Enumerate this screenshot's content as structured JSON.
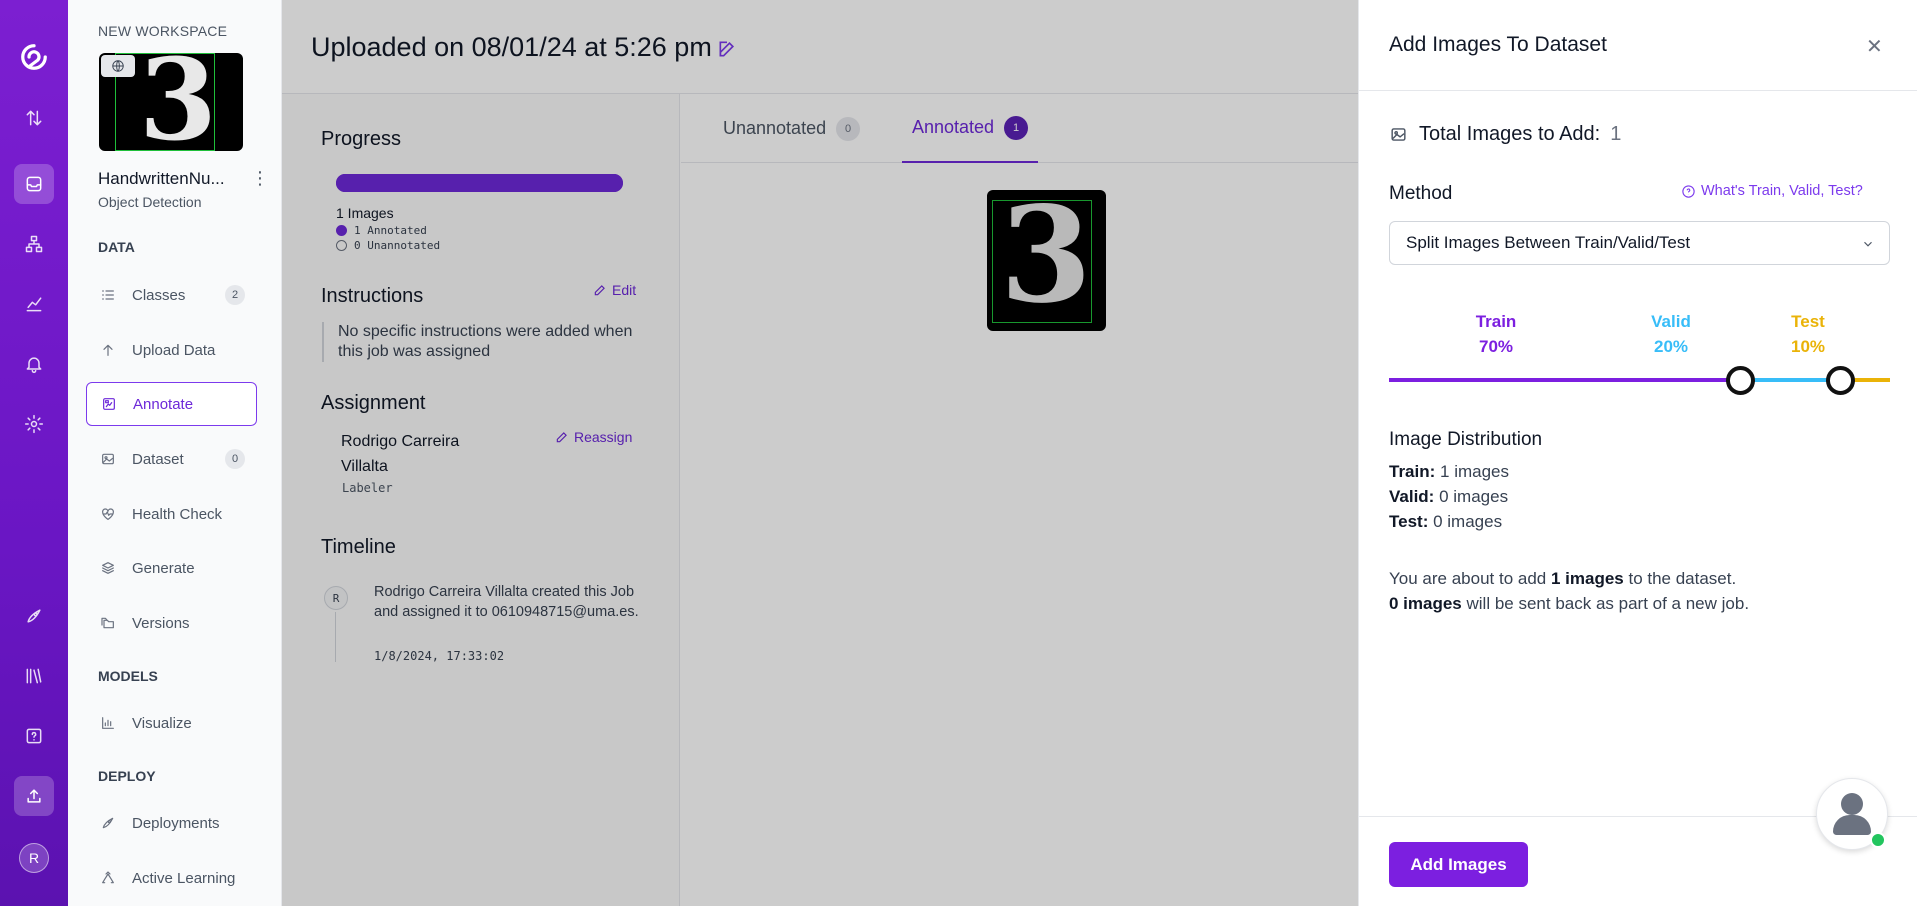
{
  "rail": {
    "items": [
      "logo-icon",
      "transfer-icon",
      "inbox-icon",
      "sitemap-icon",
      "chart-icon",
      "bell-icon",
      "gear-icon",
      "rocket-icon",
      "library-icon",
      "help-icon",
      "upload-icon"
    ],
    "avatar_initial": "R"
  },
  "sidebar": {
    "workspace_label": "NEW WORKSPACE",
    "project_name": "HandwrittenNu...",
    "project_type": "Object Detection",
    "sections": {
      "data": "DATA",
      "models": "MODELS",
      "deploy": "DEPLOY"
    },
    "items": [
      {
        "label": "Classes",
        "count": "2",
        "icon": "list-icon"
      },
      {
        "label": "Upload Data",
        "icon": "arrow-up-icon"
      },
      {
        "label": "Annotate",
        "icon": "annotate-icon",
        "active": true
      },
      {
        "label": "Dataset",
        "count": "0",
        "icon": "image-icon"
      },
      {
        "label": "Health Check",
        "icon": "heart-pulse-icon"
      },
      {
        "label": "Generate",
        "icon": "layers-icon"
      },
      {
        "label": "Versions",
        "icon": "folders-icon"
      },
      {
        "label": "Visualize",
        "icon": "bar-chart-icon"
      },
      {
        "label": "Deployments",
        "icon": "rocket-icon"
      },
      {
        "label": "Active Learning",
        "icon": "recycle-icon"
      }
    ]
  },
  "header": {
    "title": "Uploaded on 08/01/24 at 5:26 pm"
  },
  "progress": {
    "title": "Progress",
    "annotated_fraction": 1.0,
    "images_text": "1 Images",
    "annotated_text": "1 Annotated",
    "unannotated_text": "0 Unannotated"
  },
  "instructions": {
    "title": "Instructions",
    "edit_label": "Edit",
    "text": "No specific instructions were added when this job was assigned"
  },
  "assignment": {
    "title": "Assignment",
    "name": "Rodrigo Carreira Villalta",
    "role": "Labeler",
    "reassign_label": "Reassign"
  },
  "timeline": {
    "title": "Timeline",
    "avatar": "R",
    "text": "Rodrigo Carreira Villalta created this Job and assigned it to 0610948715@uma.es.",
    "time": "1/8/2024, 17:33:02"
  },
  "tabs": [
    {
      "label": "Unannotated",
      "count": "0"
    },
    {
      "label": "Annotated",
      "count": "1",
      "active": true
    }
  ],
  "drawer": {
    "title": "Add Images To Dataset",
    "close": "✕",
    "total_label": "Total Images to Add:",
    "total_value": "1",
    "method_label": "Method",
    "help_link": "What's Train, Valid, Test?",
    "method_value": "Split Images Between Train/Valid/Test",
    "split": {
      "train": {
        "label": "Train",
        "pct": "70%",
        "value": 70,
        "color": "#7c1fe0"
      },
      "valid": {
        "label": "Valid",
        "pct": "20%",
        "value": 20,
        "color": "#38bdf8"
      },
      "test": {
        "label": "Test",
        "pct": "10%",
        "value": 10,
        "color": "#eab308"
      }
    },
    "distribution": {
      "title": "Image Distribution",
      "train_label": "Train:",
      "train_value": "1 images",
      "valid_label": "Valid:",
      "valid_value": "0 images",
      "test_label": "Test:",
      "test_value": "0 images"
    },
    "summary": {
      "line1_pre": "You are about to add",
      "line1_bold": "1 images",
      "line1_post": "to the dataset.",
      "line2_bold": "0 images",
      "line2_post": "will be sent back as part of a new job."
    },
    "add_button": "Add Images"
  }
}
